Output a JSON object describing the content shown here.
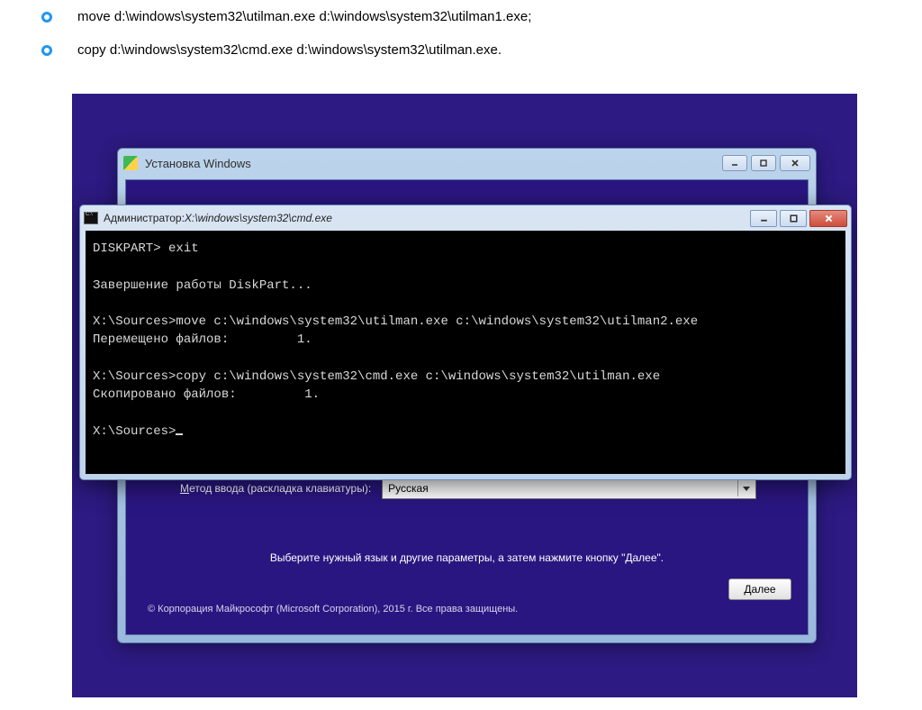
{
  "article": {
    "items": [
      {
        "cmd": "move d:\\windows\\system32\\utilman.exe d:\\windows\\system32\\utilman1.exe;"
      },
      {
        "cmd": "copy d:\\windows\\system32\\cmd.exe d:\\windows\\system32\\utilman.exe."
      }
    ]
  },
  "installer": {
    "title": "Установка Windows",
    "input_label": "Метод ввода (раскладка клавиатуры):",
    "input_label_u": "М",
    "input_value": "Русская",
    "hint": "Выберите нужный язык и другие параметры, а затем нажмите кнопку \"Далее\".",
    "next": "Далее",
    "copyright": "© Корпорация Майкрософт (Microsoft Corporation), 2015 г. Все права защищены."
  },
  "cmd": {
    "title_prefix": "Администратор: ",
    "title_path": "X:\\windows\\system32\\cmd.exe",
    "lines": [
      "DISKPART> exit",
      "",
      "Завершение работы DiskPart...",
      "",
      "X:\\Sources>move c:\\windows\\system32\\utilman.exe c:\\windows\\system32\\utilman2.exe",
      "Перемещено файлов:         1.",
      "",
      "X:\\Sources>copy c:\\windows\\system32\\cmd.exe c:\\windows\\system32\\utilman.exe",
      "Скопировано файлов:         1.",
      "",
      "X:\\Sources>"
    ]
  },
  "colors": {
    "desktop": "#2d1a82",
    "accent": "#2196f3"
  }
}
